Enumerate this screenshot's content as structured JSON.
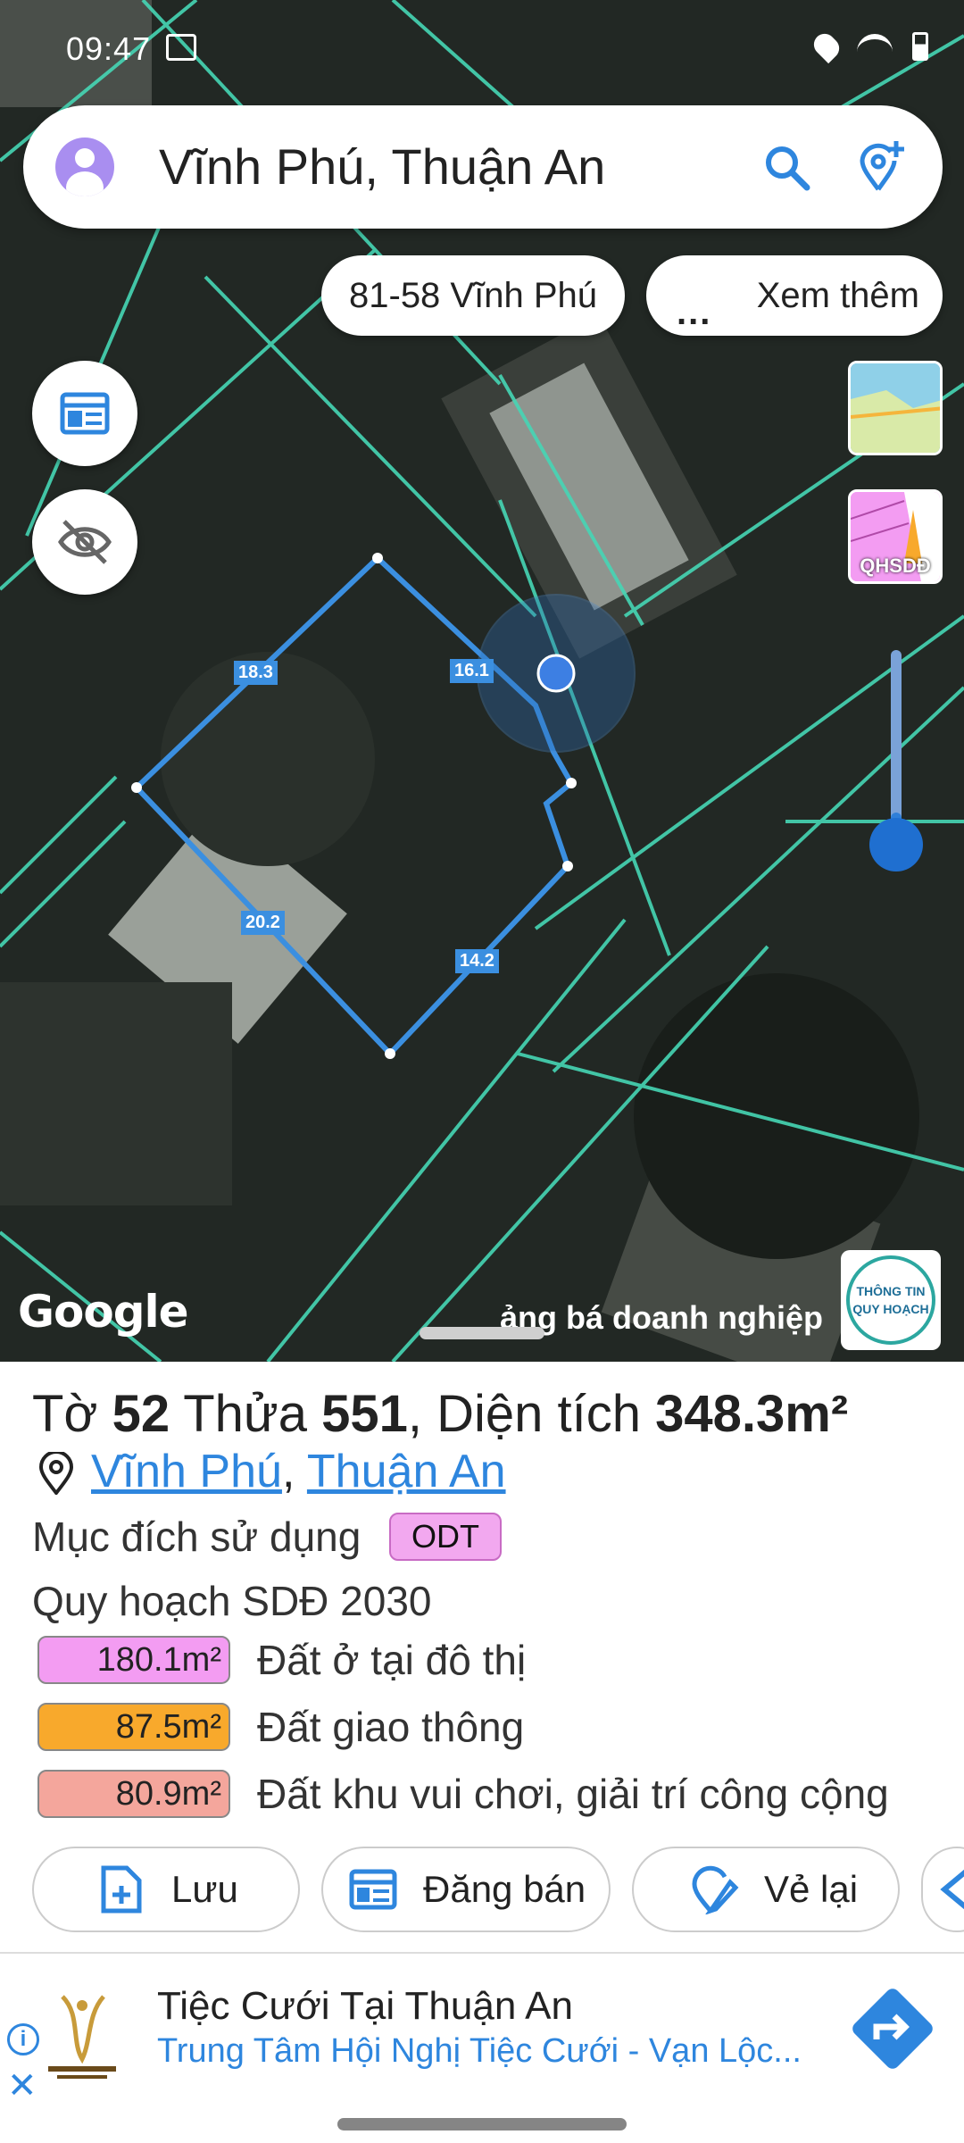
{
  "status_bar": {
    "time": "09:47"
  },
  "search": {
    "query": "Vĩnh Phú, Thuận An"
  },
  "chips": {
    "address": "81-58 Vĩnh Phú",
    "more_dots": "...",
    "more_label": "Xem thêm"
  },
  "layers": {
    "planning_label": "QHSDĐ"
  },
  "map": {
    "edge_labels": [
      "18.3",
      "16.1",
      "20.2",
      "14.2"
    ],
    "google_label": "Google",
    "ad_strip": "ảng bá doanh nghiệp",
    "planning_badge_line1": "THÔNG TIN",
    "planning_badge_line2": "QUY HOẠCH",
    "zoom_level": 0.85
  },
  "parcel": {
    "sheet_prefix": "Tờ",
    "sheet_number": "52",
    "plot_prefix": "Thửa",
    "plot_number": "551",
    "area_prefix": "Diện tích",
    "area_value": "348.3m²",
    "ward": "Vĩnh Phú",
    "separator": ",",
    "district": "Thuận An",
    "purpose_label": "Mục đích sử dụng",
    "purpose_code": "ODT",
    "plan_title": "Quy hoạch SDĐ 2030",
    "plan_items": [
      {
        "area": "180.1m²",
        "label": "Đất ở tại đô thị",
        "color": "#f39cf2"
      },
      {
        "area": "87.5m²",
        "label": "Đất giao thông",
        "color": "#f8a92c"
      },
      {
        "area": "80.9m²",
        "label": "Đất khu vui chơi, giải trí công cộng",
        "color": "#f4a69c"
      }
    ]
  },
  "actions": {
    "save": "Lưu",
    "sell": "Đăng bán",
    "redraw": "Vẻ lại"
  },
  "ad": {
    "title": "Tiệc Cưới Tại Thuận An",
    "subtitle": "Trung Tâm Hội Nghị Tiệc Cưới - Vạn Lộc...",
    "info_glyph": "i",
    "close_glyph": "✕"
  },
  "colors": {
    "accent": "#2e86de",
    "parcel_line": "#3b8fe0",
    "cadastral_line": "#46d6b5"
  }
}
